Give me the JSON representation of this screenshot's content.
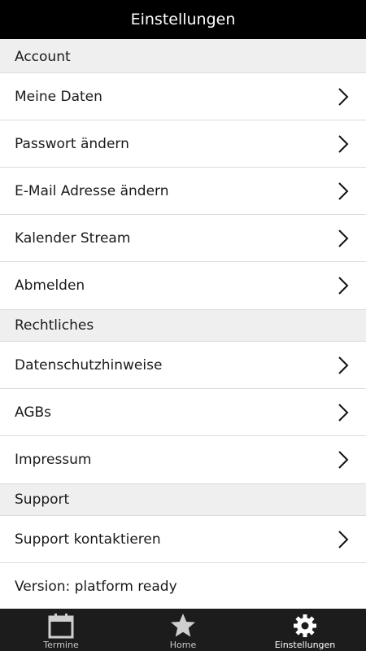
{
  "header": {
    "title": "Einstellungen"
  },
  "sections": {
    "account": {
      "title": "Account",
      "items": [
        "Meine Daten",
        "Passwort ändern",
        "E-Mail Adresse ändern",
        "Kalender Stream",
        "Abmelden"
      ]
    },
    "legal": {
      "title": "Rechtliches",
      "items": [
        "Datenschutzhinweise",
        "AGBs",
        "Impressum"
      ]
    },
    "support": {
      "title": "Support",
      "items": [
        "Support kontaktieren"
      ],
      "version": "Version: platform ready"
    }
  },
  "tabbar": {
    "tabs": [
      {
        "label": "Termine",
        "icon": "calendar-icon"
      },
      {
        "label": "Home",
        "icon": "star-icon"
      },
      {
        "label": "Einstellungen",
        "icon": "gear-icon",
        "active": true
      }
    ]
  },
  "colors": {
    "header_bg": "#000000",
    "section_bg": "#efefef",
    "tabbar_bg": "#1c1c1c"
  }
}
